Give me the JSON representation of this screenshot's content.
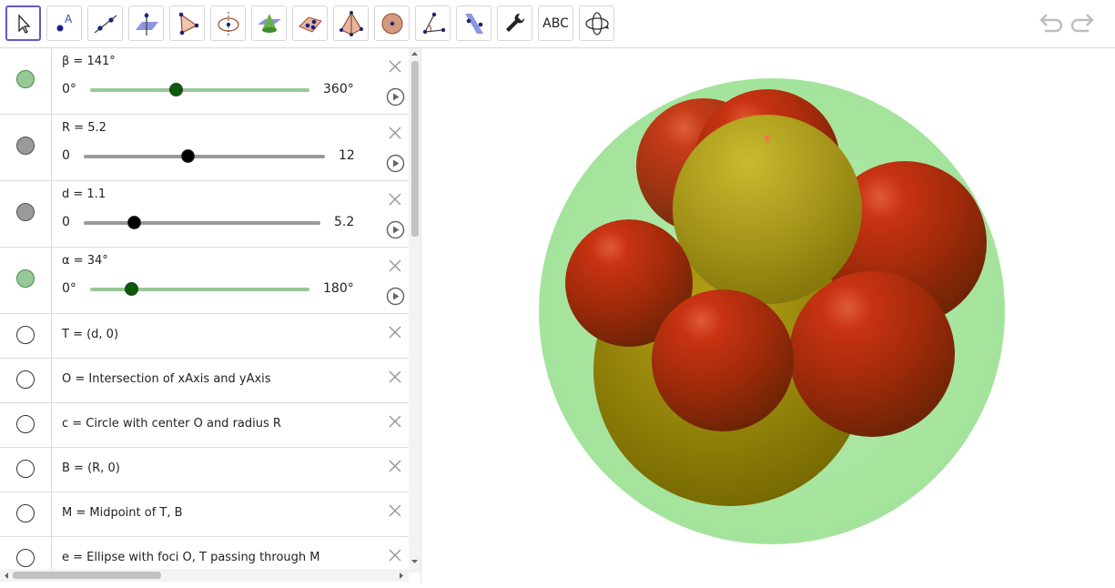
{
  "toolbar": {
    "tools": [
      {
        "name": "move-tool-icon"
      },
      {
        "name": "point-tool-icon"
      },
      {
        "name": "line-tool-icon"
      },
      {
        "name": "perpendicular-plane-tool-icon"
      },
      {
        "name": "polygon-tool-icon"
      },
      {
        "name": "circle-axis-tool-icon"
      },
      {
        "name": "intersect-curve-tool-icon"
      },
      {
        "name": "plane-through-points-tool-icon"
      },
      {
        "name": "pyramid-tool-icon"
      },
      {
        "name": "sphere-tool-icon"
      },
      {
        "name": "angle-tool-icon"
      },
      {
        "name": "reflect-plane-tool-icon"
      },
      {
        "name": "settings-tool-icon"
      },
      {
        "name": "text-tool-icon",
        "text": "ABC"
      },
      {
        "name": "rotate-view-tool-icon"
      }
    ]
  },
  "algebra": {
    "sliders": [
      {
        "label": "β = 141°",
        "min": "0°",
        "max": "360°",
        "value": 141,
        "range": [
          0,
          360
        ],
        "color": "#97c897",
        "knob": "#0a5c0a",
        "visible": true
      },
      {
        "label": "R = 5.2",
        "min": "0",
        "max": "12",
        "value": 5.2,
        "range": [
          0,
          12
        ],
        "color": "#9a9a9a",
        "knob": "#000000",
        "visible": false
      },
      {
        "label": "d = 1.1",
        "min": "0",
        "max": "5.2",
        "value": 1.1,
        "range": [
          0,
          5.2
        ],
        "color": "#9a9a9a",
        "knob": "#000000",
        "visible": false
      },
      {
        "label": "α = 34°",
        "min": "0°",
        "max": "180°",
        "value": 34,
        "range": [
          0,
          180
        ],
        "color": "#97c897",
        "knob": "#0a5c0a",
        "visible": true
      }
    ],
    "definitions": [
      "T = (d, 0)",
      "O = Intersection of xAxis and yAxis",
      "c = Circle with center O and radius R",
      "B = (R, 0)",
      "M = Midpoint of T, B",
      "e = Ellipse with foci O, T passing through M"
    ]
  },
  "colors": {
    "accent": "#6557d2",
    "green_sphere": "#a8e6a0",
    "red_sphere": "#b52c0c",
    "yellow_sphere": "#a89a10"
  }
}
